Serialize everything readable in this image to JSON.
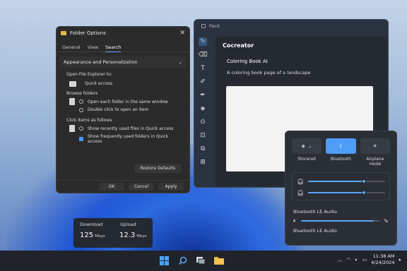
{
  "folder_options": {
    "title": "Folder Options",
    "tabs": [
      "General",
      "View",
      "Search"
    ],
    "section": "Appearance and Personalization",
    "open_label": "Open File Explorer to:",
    "open_value": "Quick access",
    "browse_label": "Browse folders",
    "browse_opts": [
      "Open each folder in the same window",
      "Double click to open an item"
    ],
    "click_label": "Click items as follows",
    "click_opts": [
      "Show recently used files in Quick access",
      "Show frequently used folders in Quick access"
    ],
    "restore": "Restore Defaults",
    "ok": "OK",
    "cancel": "Cancel",
    "apply": "Apply"
  },
  "paint": {
    "title": "Paint",
    "panel_title": "Cocreator",
    "card_title": "Coloring Book AI",
    "prompt": "A coloring book page of a landscape"
  },
  "quick_settings": {
    "tiles": [
      "Storanet",
      "Bluetooth",
      "Airplane mode"
    ],
    "slider1": 0.72,
    "slider2": 0.72,
    "device1": "Bluetooth LE Audio",
    "volume": 0.93,
    "device2": "Bluetooth LE Audio"
  },
  "network_widget": {
    "download_label": "Download",
    "upload_label": "Upload",
    "download_value": "125",
    "upload_value": "12.3",
    "unit": "Mbps"
  },
  "taskbar": {
    "time": "11:38 AM",
    "date": "4/24/2024"
  },
  "colors": {
    "accent": "#4f9cf7"
  }
}
